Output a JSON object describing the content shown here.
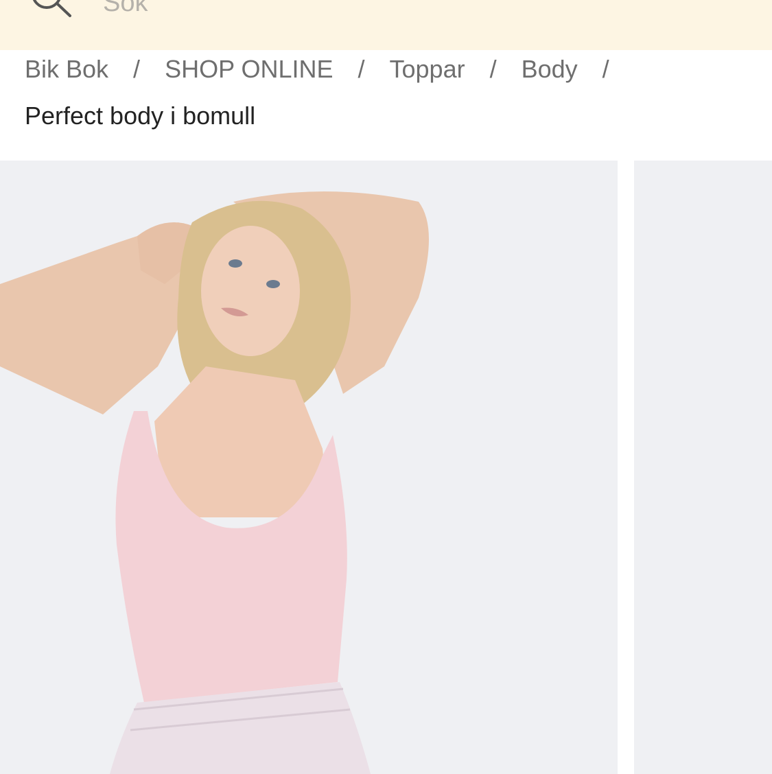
{
  "search": {
    "placeholder": "Sök",
    "icon": "search-icon"
  },
  "breadcrumb": {
    "items": [
      "Bik Bok",
      "SHOP ONLINE",
      "Toppar",
      "Body"
    ],
    "separator": "/"
  },
  "product": {
    "title": "Perfect body i bomull"
  },
  "colors": {
    "search_bar_bg": "#fdf5e3",
    "image_bg": "#eff0f3",
    "breadcrumb_text": "#6e6e6e",
    "title_text": "#222222"
  }
}
